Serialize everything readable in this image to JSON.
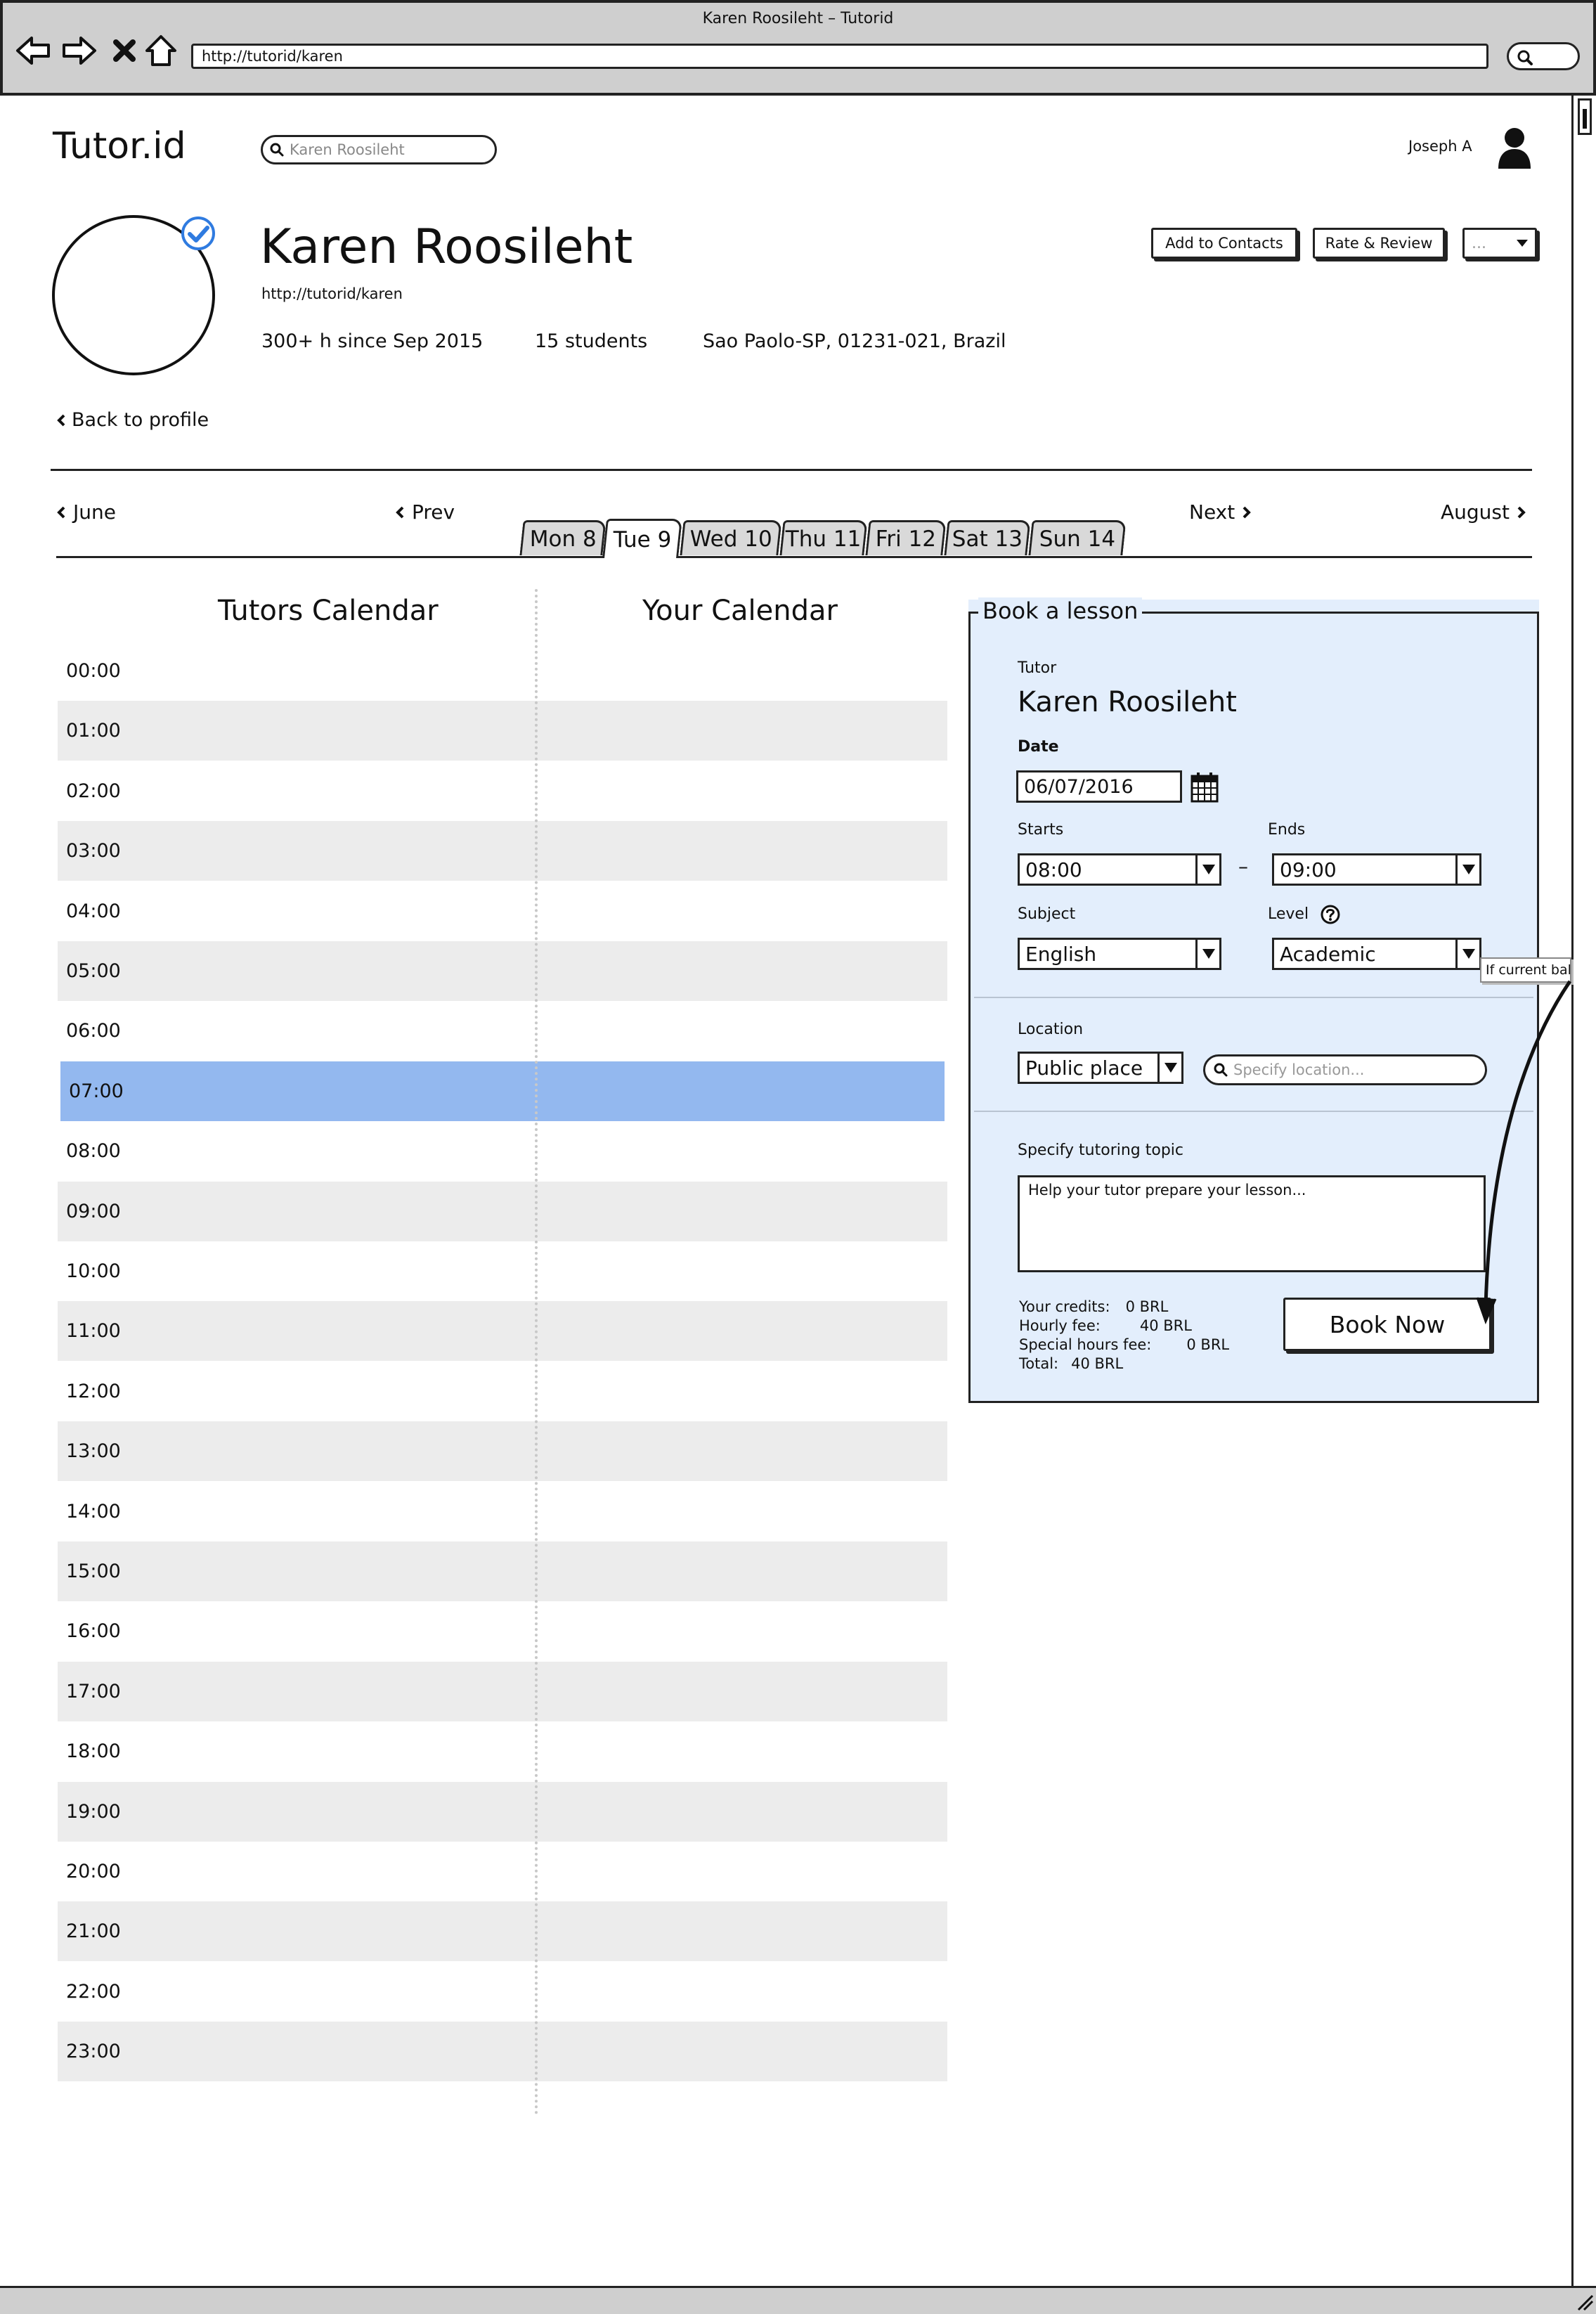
{
  "browser": {
    "window_title": "Karen Roosileht – Tutorid",
    "url": "http://tutorid/karen"
  },
  "header": {
    "logo": "Tutor.id",
    "search_value": "Karen Roosileht",
    "user_name": "Joseph A"
  },
  "profile": {
    "name": "Karen Roosileht",
    "url": "http://tutorid/karen",
    "hours": "300+ h since Sep 2015",
    "students": "15 students",
    "location": "Sao Paolo-SP, 01231-021, Brazil",
    "back_link": "Back to profile",
    "add_contacts": "Add to Contacts",
    "rate_review": "Rate & Review",
    "more": "..."
  },
  "week_nav": {
    "prev_month": "June",
    "prev": "Prev",
    "next": "Next",
    "next_month": "August",
    "days": [
      "Mon 8",
      "Tue 9",
      "Wed 10",
      "Thu 11",
      "Fri 12",
      "Sat 13",
      "Sun 14"
    ],
    "active_day": "Tue 9"
  },
  "calendar": {
    "tutors_title": "Tutors Calendar",
    "your_title": "Your Calendar",
    "hours": [
      "00:00",
      "01:00",
      "02:00",
      "03:00",
      "04:00",
      "05:00",
      "06:00",
      "07:00",
      "08:00",
      "09:00",
      "10:00",
      "11:00",
      "12:00",
      "13:00",
      "14:00",
      "15:00",
      "16:00",
      "17:00",
      "18:00",
      "19:00",
      "20:00",
      "21:00",
      "22:00",
      "23:00"
    ],
    "selected_hour": "07:00",
    "highlight_color": "#93b8ef"
  },
  "booking": {
    "legend": "Book a lesson",
    "tutor_label": "Tutor",
    "tutor_name": "Karen Roosileht",
    "date_label": "Date",
    "date_value": "06/07/2016",
    "starts_label": "Starts",
    "starts_value": "08:00",
    "ends_label": "Ends",
    "ends_value": "09:00",
    "dash": "–",
    "subject_label": "Subject",
    "subject_value": "English",
    "level_label": "Level",
    "level_value": "Academic",
    "location_label": "Location",
    "location_value": "Public place",
    "location_placeholder": "Specify location...",
    "topic_label": "Specify tutoring topic",
    "topic_placeholder": "Help your tutor prepare your lesson...",
    "credits_label": "Your credits:",
    "credits_value": "0 BRL",
    "hourly_label": "Hourly fee:",
    "hourly_value": "40 BRL",
    "special_label": "Special hours fee:",
    "special_value": "0 BRL",
    "total_label": "Total:",
    "total_value": "40 BRL",
    "book_button": "Book Now",
    "panel_color": "#e3eefc"
  },
  "annotation": {
    "tooltip": "If current balar"
  },
  "icons": [
    "back-arrow-icon",
    "forward-arrow-icon",
    "stop-icon",
    "home-icon",
    "search-icon",
    "user-icon",
    "verified-badge-icon",
    "calendar-icon",
    "help-icon",
    "chevron-left-icon",
    "chevron-right-icon",
    "dropdown-arrow-icon"
  ]
}
